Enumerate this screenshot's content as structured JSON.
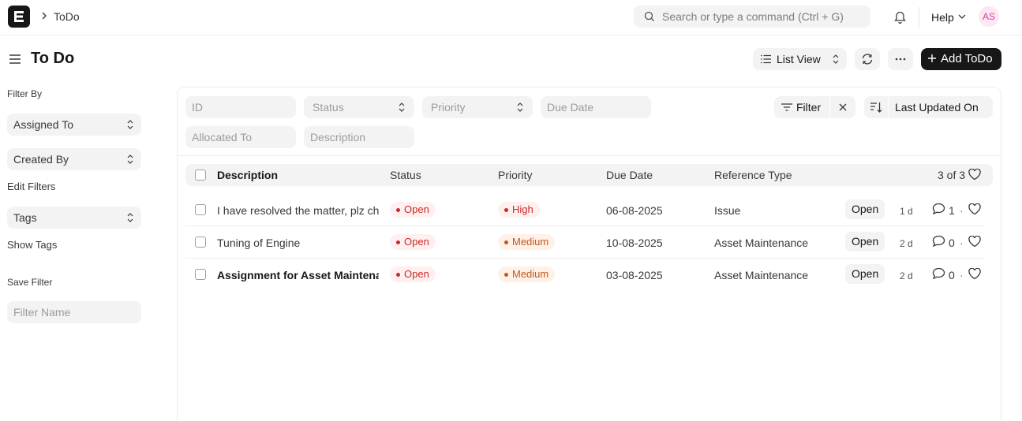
{
  "navbar": {
    "breadcrumb": "ToDo",
    "search_placeholder": "Search or type a command (Ctrl + G)",
    "help_label": "Help",
    "avatar_initials": "AS"
  },
  "page": {
    "title": "To Do",
    "list_view_label": "List View",
    "add_label": "Add ToDo"
  },
  "sidebar": {
    "filter_by_label": "Filter By",
    "assigned_to": "Assigned To",
    "created_by": "Created By",
    "edit_filters": "Edit Filters",
    "tags": "Tags",
    "show_tags": "Show Tags",
    "save_filter_label": "Save Filter",
    "filter_name_placeholder": "Filter Name"
  },
  "filters": {
    "id_placeholder": "ID",
    "status_label": "Status",
    "priority_label": "Priority",
    "due_date_placeholder": "Due Date",
    "allocated_to_placeholder": "Allocated To",
    "description_placeholder": "Description",
    "filter_button": "Filter",
    "sort_label": "Last Updated On"
  },
  "table": {
    "headers": {
      "description": "Description",
      "status": "Status",
      "priority": "Priority",
      "due_date": "Due Date",
      "reference_type": "Reference Type"
    },
    "count": "3 of 3",
    "rows": [
      {
        "description": "I have resolved the matter, plz check",
        "status": "Open",
        "priority": "High",
        "due_date": "06-08-2025",
        "reference_type": "Issue",
        "tag": "Open",
        "age": "1 d",
        "comments": "1",
        "sep": "·"
      },
      {
        "description": "Tuning of Engine",
        "status": "Open",
        "priority": "Medium",
        "due_date": "10-08-2025",
        "reference_type": "Asset Maintenance",
        "tag": "Open",
        "age": "2 d",
        "comments": "0",
        "sep": "·"
      },
      {
        "description": "Assignment for Asset Maintenance",
        "status": "Open",
        "priority": "Medium",
        "due_date": "03-08-2025",
        "reference_type": "Asset Maintenance",
        "tag": "Open",
        "age": "2 d",
        "comments": "0",
        "sep": "·"
      }
    ]
  },
  "colors": {
    "brand": "#171717",
    "open_red": "#cc2929",
    "medium_orange": "#c35a1c",
    "avatar_pink": "#e03ea4"
  },
  "icons": [
    "frappe-logo-icon",
    "chevron-right-icon",
    "search-icon",
    "bell-icon",
    "chevron-down-icon",
    "hamburger-icon",
    "list-icon",
    "updown-icon",
    "refresh-icon",
    "more-icon",
    "plus-icon",
    "filter-icon",
    "close-icon",
    "sort-icon",
    "comment-icon",
    "heart-icon"
  ]
}
